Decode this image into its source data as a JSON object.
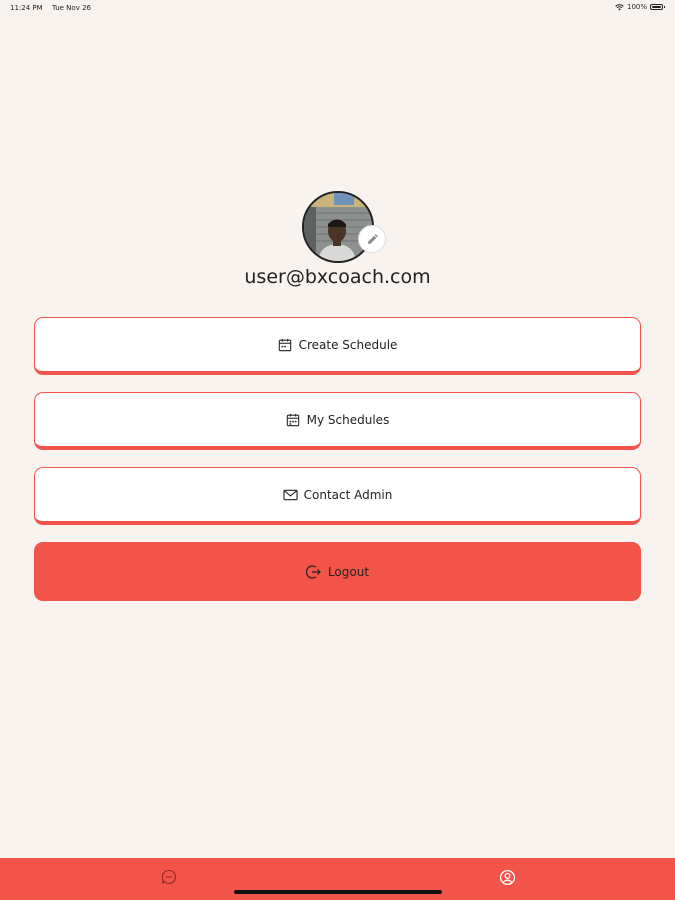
{
  "status_bar": {
    "time": "11:24 PM",
    "date": "Tue Nov 26",
    "battery": "100%"
  },
  "profile": {
    "email": "user@bxcoach.com"
  },
  "menu": {
    "create_schedule": "Create Schedule",
    "my_schedules": "My Schedules",
    "contact_admin": "Contact Admin",
    "logout": "Logout"
  },
  "colors": {
    "accent": "#f2544a",
    "background": "#f8f3ee"
  },
  "icons": {
    "create_schedule": "calendar-icon",
    "my_schedules": "calendar-icon",
    "contact_admin": "mail-icon",
    "logout": "logout-icon",
    "edit": "pencil-icon",
    "tab_chat": "chat-icon",
    "tab_profile": "profile-icon"
  }
}
